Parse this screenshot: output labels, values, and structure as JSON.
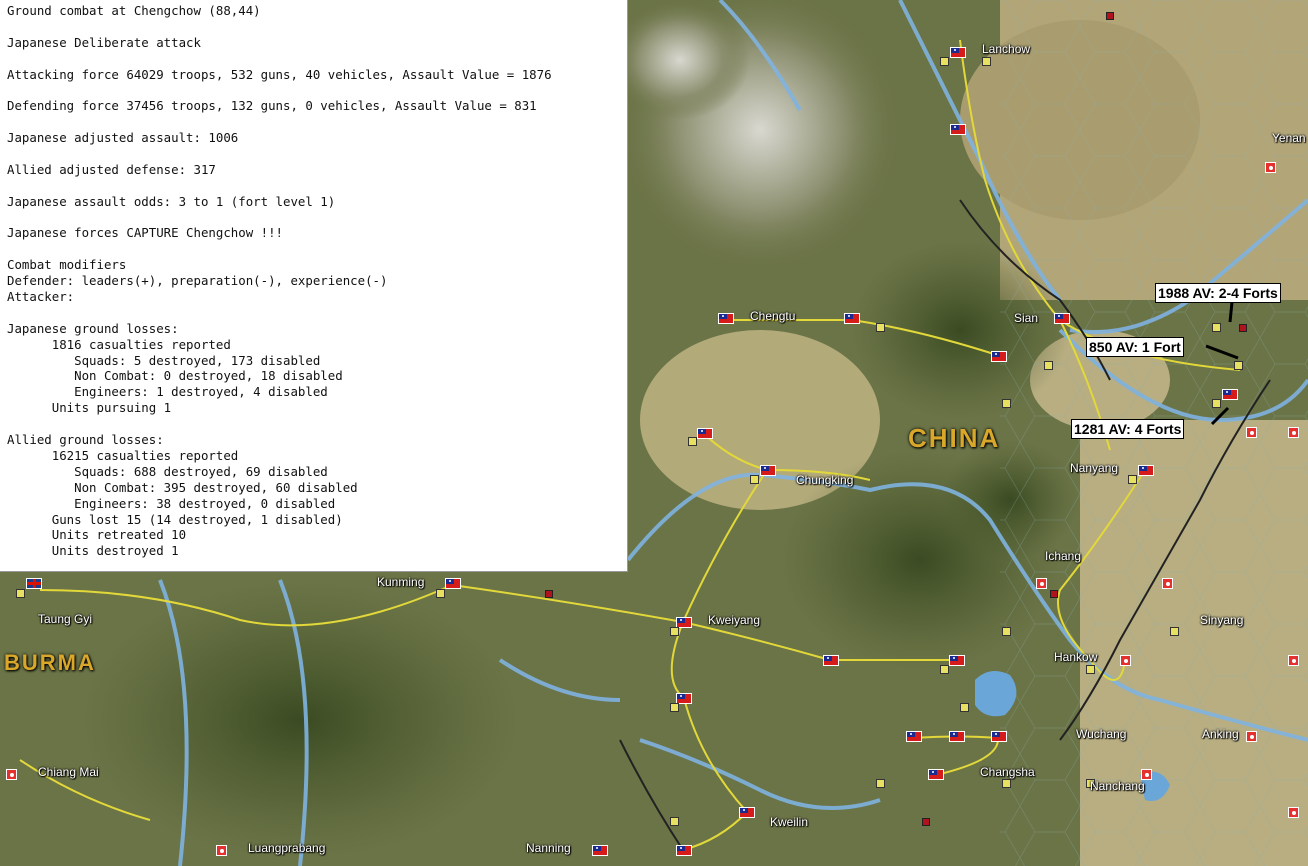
{
  "report": {
    "lines": [
      "Ground combat at Chengchow (88,44)",
      "",
      "Japanese Deliberate attack",
      "",
      "Attacking force 64029 troops, 532 guns, 40 vehicles, Assault Value = 1876",
      "",
      "Defending force 37456 troops, 132 guns, 0 vehicles, Assault Value = 831",
      "",
      "Japanese adjusted assault: 1006",
      "",
      "Allied adjusted defense: 317",
      "",
      "Japanese assault odds: 3 to 1 (fort level 1)",
      "",
      "Japanese forces CAPTURE Chengchow !!!",
      "",
      "Combat modifiers",
      "Defender: leaders(+), preparation(-), experience(-)",
      "Attacker:",
      "",
      "Japanese ground losses:",
      "      1816 casualties reported",
      "         Squads: 5 destroyed, 173 disabled",
      "         Non Combat: 0 destroyed, 18 disabled",
      "         Engineers: 1 destroyed, 4 disabled",
      "      Units pursuing 1",
      "",
      "Allied ground losses:",
      "      16215 casualties reported",
      "         Squads: 688 destroyed, 69 disabled",
      "         Non Combat: 395 destroyed, 60 disabled",
      "         Engineers: 38 destroyed, 0 disabled",
      "      Guns lost 15 (14 destroyed, 1 disabled)",
      "      Units retreated 10",
      "      Units destroyed 1"
    ]
  },
  "map": {
    "regions": {
      "china": "CHINA",
      "burma": "BURMA"
    },
    "places": {
      "lanchow": "Lanchow",
      "yenan": "Yenan",
      "chengtu": "Chengtu",
      "sian": "Sian",
      "chungking": "Chungking",
      "nanyang": "Nanyang",
      "kunming": "Kunming",
      "taunggyi": "Taung Gyi",
      "kweiyang": "Kweiyang",
      "ichang": "Ichang",
      "sinyang": "Sinyang",
      "hankow": "Hankow",
      "wuchang": "Wuchang",
      "anking": "Anking",
      "changsha": "Changsha",
      "nanchang": "Nanchang",
      "chiangmai": "Chiang Mai",
      "kweilin": "Kweilin",
      "luangprabang": "Luangprabang",
      "nanning": "Nanning"
    },
    "annotations": {
      "a1": "1988 AV: 2-4 Forts",
      "a2": "850 AV: 1 Fort",
      "a3": "1281 AV: 4 Forts"
    }
  }
}
